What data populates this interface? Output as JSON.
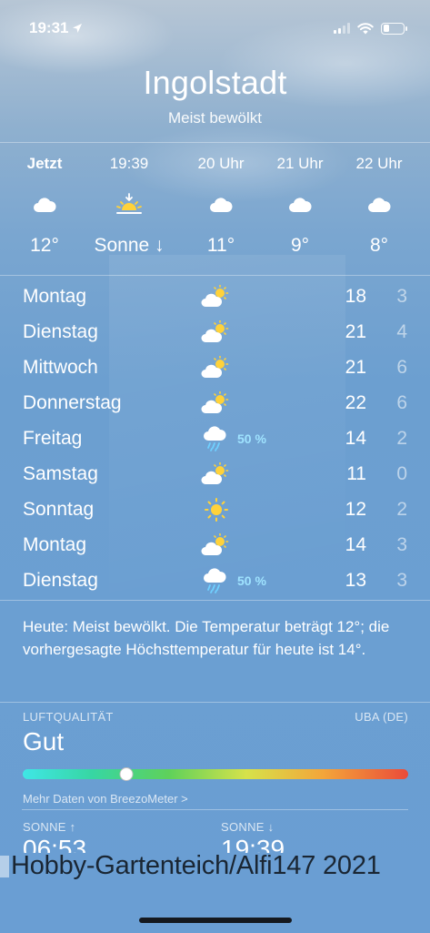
{
  "status_bar": {
    "time": "19:31",
    "battery_level": 0.3
  },
  "header": {
    "city": "Ingolstadt",
    "condition": "Meist bewölkt"
  },
  "hourly": [
    {
      "label": "Jetzt",
      "icon": "cloud-icon",
      "temp": "12°"
    },
    {
      "label": "19:39",
      "icon": "sunset-icon",
      "temp": "Sonne ↓"
    },
    {
      "label": "20 Uhr",
      "icon": "cloud-icon",
      "temp": "11°"
    },
    {
      "label": "21 Uhr",
      "icon": "cloud-icon",
      "temp": "9°"
    },
    {
      "label": "22 Uhr",
      "icon": "cloud-icon",
      "temp": "8°"
    }
  ],
  "daily": [
    {
      "day": "Montag",
      "icon": "partly-cloudy-icon",
      "precip": "",
      "high": "18",
      "low": "3"
    },
    {
      "day": "Dienstag",
      "icon": "partly-cloudy-icon",
      "precip": "",
      "high": "21",
      "low": "4"
    },
    {
      "day": "Mittwoch",
      "icon": "partly-cloudy-icon",
      "precip": "",
      "high": "21",
      "low": "6"
    },
    {
      "day": "Donnerstag",
      "icon": "partly-cloudy-icon",
      "precip": "",
      "high": "22",
      "low": "6"
    },
    {
      "day": "Freitag",
      "icon": "rain-icon",
      "precip": "50 %",
      "high": "14",
      "low": "2"
    },
    {
      "day": "Samstag",
      "icon": "partly-cloudy-icon",
      "precip": "",
      "high": "11",
      "low": "0"
    },
    {
      "day": "Sonntag",
      "icon": "sun-icon",
      "precip": "",
      "high": "12",
      "low": "2"
    },
    {
      "day": "Montag",
      "icon": "partly-cloudy-icon",
      "precip": "",
      "high": "14",
      "low": "3"
    },
    {
      "day": "Dienstag",
      "icon": "rain-icon",
      "precip": "50 %",
      "high": "13",
      "low": "3"
    }
  ],
  "summary": "Heute: Meist bewölkt. Die Temperatur beträgt 12°; die vorhergesagte Höchsttemperatur für heute ist 14°.",
  "air_quality": {
    "title": "LUFTQUALITÄT",
    "source": "UBA (DE)",
    "value": "Gut",
    "level": 0.27,
    "link": "Mehr Daten von BreezoMeter >"
  },
  "sun": {
    "sunrise_label": "SONNE ↑",
    "sunrise_value": "06:53",
    "sunset_label": "SONNE ↓",
    "sunset_value": "19:39"
  },
  "watermark": "Hobby-Gartenteich/Alfi147 2021"
}
